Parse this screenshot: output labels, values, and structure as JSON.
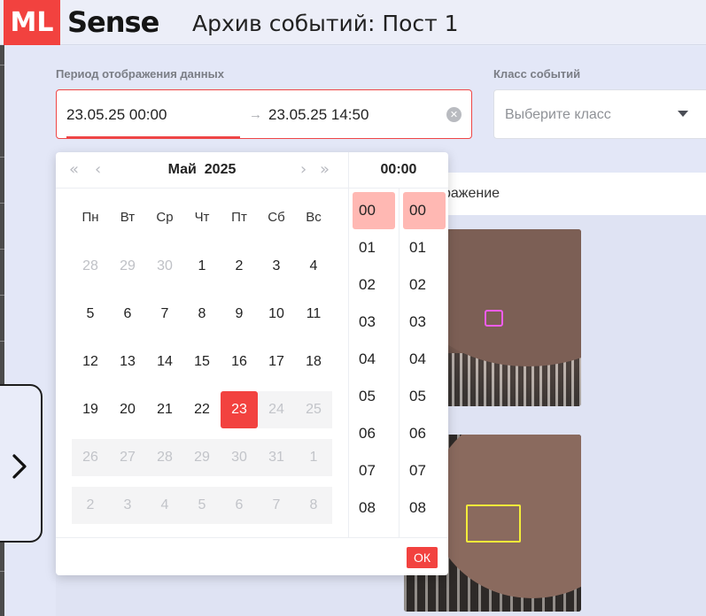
{
  "header": {
    "logo_ml": "ML",
    "logo_sense": "Sense",
    "title": "Архив событий: Пост 1"
  },
  "filters": {
    "period_label": "Период отображения данных",
    "range_start": "23.05.25 00:00",
    "range_arrow": "→",
    "range_end": "23.05.25 14:50",
    "class_label": "Класс событий",
    "class_placeholder": "Выберите класс"
  },
  "events": {
    "header_text": "ражение"
  },
  "calendar": {
    "nav_prev_year": "«",
    "nav_prev_month": "‹",
    "nav_next_month": "›",
    "nav_next_year": "»",
    "month": "Май",
    "year": "2025",
    "weekdays": [
      "Пн",
      "Вт",
      "Ср",
      "Чт",
      "Пт",
      "Сб",
      "Вс"
    ],
    "weeks": [
      [
        "28",
        "29",
        "30",
        "1",
        "2",
        "3",
        "4"
      ],
      [
        "5",
        "6",
        "7",
        "8",
        "9",
        "10",
        "11"
      ],
      [
        "12",
        "13",
        "14",
        "15",
        "16",
        "17",
        "18"
      ],
      [
        "19",
        "20",
        "21",
        "22",
        "23",
        "24",
        "25"
      ],
      [
        "26",
        "27",
        "28",
        "29",
        "30",
        "31",
        "1"
      ],
      [
        "2",
        "3",
        "4",
        "5",
        "6",
        "7",
        "8"
      ]
    ],
    "selected_day": "23"
  },
  "time": {
    "title": "00:00",
    "hours": [
      "00",
      "01",
      "02",
      "03",
      "04",
      "05",
      "06",
      "07",
      "08"
    ],
    "minutes": [
      "00",
      "01",
      "02",
      "03",
      "04",
      "05",
      "06",
      "07",
      "08"
    ],
    "selected_hour": "00",
    "selected_minute": "00"
  },
  "ok_label": "ОК",
  "colors": {
    "accent": "#f2423f",
    "selected_time_bg": "#ffb8b3",
    "bbox_pink": "#f05cf0",
    "bbox_yellow": "#f3ec3a"
  }
}
